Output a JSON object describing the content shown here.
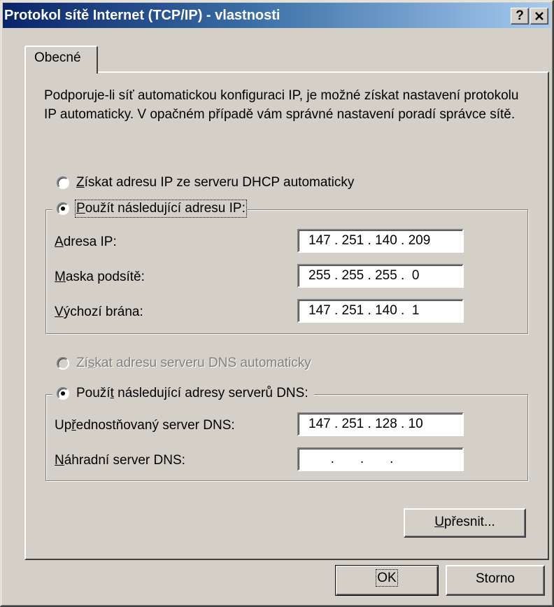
{
  "window": {
    "title": "Protokol sítě Internet (TCP/IP) - vlastnosti",
    "help_button": "?",
    "close_button": "✕"
  },
  "tabs": [
    {
      "label": "Obecné",
      "selected": true
    }
  ],
  "description": "Podporuje-li síť automatickou konfiguraci IP, je možné získat nastavení protokolu IP automaticky. V opačném případě vám správné nastavení poradí správce sítě.",
  "ip_section": {
    "auto_option": {
      "prefix": "",
      "mnemonic": "Z",
      "rest": "ískat adresu IP ze serveru DHCP automaticky",
      "checked": false
    },
    "manual_option": {
      "prefix": "",
      "mnemonic": "P",
      "rest": "oužít následující adresu IP:",
      "checked": true
    },
    "fields": [
      {
        "mnemonic": "A",
        "rest": "dresa IP:",
        "value": "147 . 251 . 140 . 209"
      },
      {
        "mnemonic": "M",
        "rest": "aska podsítě:",
        "value": "255 . 255 . 255 .  0"
      },
      {
        "mnemonic": "V",
        "rest": "ýchozí brána:",
        "value": "147 . 251 . 140 .  1"
      }
    ]
  },
  "dns_section": {
    "auto_option": {
      "prefix": "Zí",
      "mnemonic": "s",
      "rest": "kat adresu serveru DNS automaticky",
      "checked": false,
      "disabled": true
    },
    "manual_option": {
      "prefix": "Použí",
      "mnemonic": "t",
      "rest": " následující adresy serverů DNS:",
      "checked": true
    },
    "fields": [
      {
        "prefix": "Up",
        "mnemonic": "ř",
        "rest": "ednostňovaný server DNS:",
        "value": "147 . 251 . 128 . 10"
      },
      {
        "prefix": "",
        "mnemonic": "N",
        "rest": "áhradní server DNS:",
        "value": "      .       .       ."
      }
    ]
  },
  "advanced_button": {
    "mnemonic": "U",
    "rest": "přesnit..."
  },
  "ok_button": "OK",
  "cancel_button": "Storno"
}
